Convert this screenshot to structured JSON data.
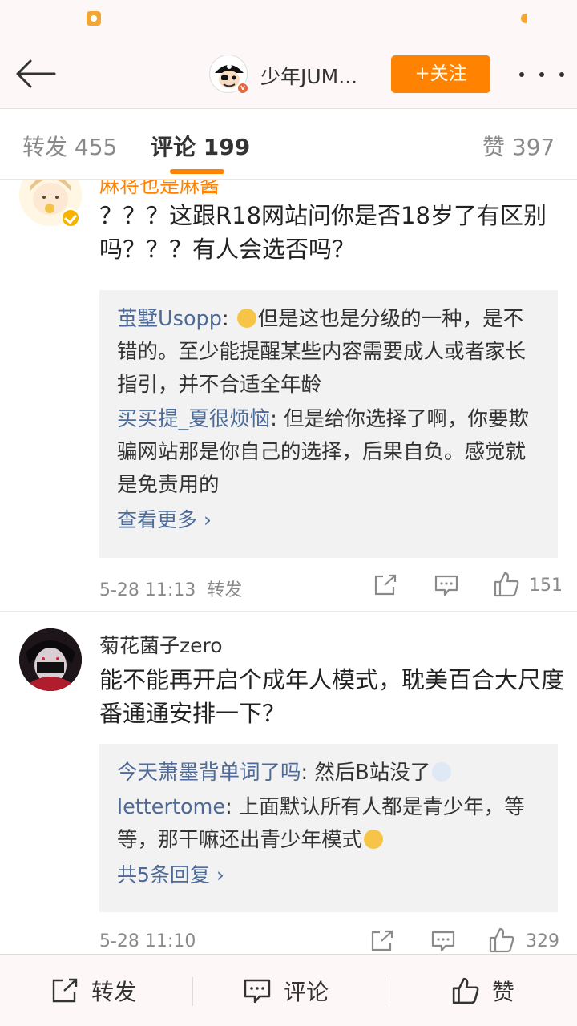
{
  "header": {
    "back_icon": "arrow-left-icon",
    "account_name": "少年JUM...",
    "account_badge": "v",
    "follow_label": "+关注",
    "more_icon": "more-dots-icon",
    "accent_color": "#ff8200"
  },
  "tabs": [
    {
      "label": "转发 455",
      "active": false
    },
    {
      "label": "评论 199",
      "active": true
    },
    {
      "label": "赞 397",
      "active": false
    }
  ],
  "comments": [
    {
      "user": "麻将也是麻酱",
      "text": "？？？这跟R18网站问你是否18岁了有区别吗？？？有人会选否吗？",
      "replies": [
        {
          "user": "茧墅Usopp",
          "sep": ": ",
          "text": "但是这也是分级的一种，是不错的。至少能提醒某些内容需要成人或者家长指引，并不合适全年龄"
        },
        {
          "user": "买买提_夏很烦恼",
          "sep": ": ",
          "text": "但是给你选择了啊，你要欺骗网站那是你自己的选择，后果自负。感觉就是免责用的"
        }
      ],
      "see_more": "查看更多 ›",
      "time": "5-28 11:13",
      "repost_label": "转发",
      "likes": "151"
    },
    {
      "user": "菊花菌子zero",
      "text": "能不能再开启个成年人模式，耽美百合大尺度番通通安排一下？",
      "replies": [
        {
          "user": "今天萧墨背单词了吗",
          "sep": ": ",
          "text": "然后B站没了"
        },
        {
          "user": "lettertome",
          "sep": ": ",
          "text": "上面默认所有人都是青少年，等等，那干嘛还出青少年模式"
        }
      ],
      "see_more": "共5条回复 ›",
      "time": "5-28 11:10",
      "likes": "329"
    }
  ],
  "bottom_bar": {
    "repost_label": "转发",
    "comment_label": "评论",
    "like_label": "赞"
  },
  "colors": {
    "link": "#4d6a99",
    "secondary_text": "#8a8a8a",
    "reply_bg": "#f2f2f2",
    "vip_badge": "#f6b400"
  }
}
